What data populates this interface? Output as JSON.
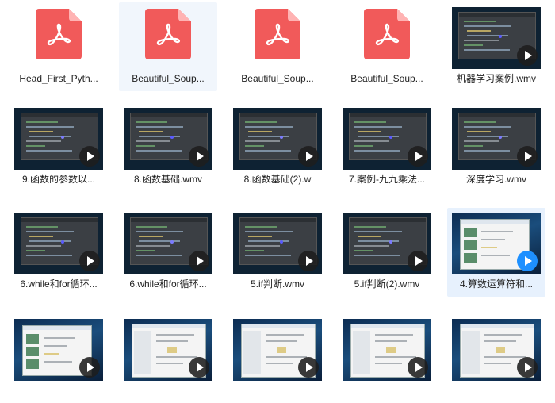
{
  "colors": {
    "pdf_red": "#f15a5a",
    "selection": "#f1f6fc",
    "hover": "#e7f1fd",
    "play_active": "#1e90ff"
  },
  "files": [
    {
      "name": "Head_First_Pyth...",
      "type": "pdf",
      "icon": "pdf-icon"
    },
    {
      "name": "Beautiful_Soup...",
      "type": "pdf",
      "icon": "pdf-icon",
      "state": "selected"
    },
    {
      "name": "Beautiful_Soup...",
      "type": "pdf",
      "icon": "pdf-icon"
    },
    {
      "name": "Beautiful_Soup...",
      "type": "pdf",
      "icon": "pdf-icon"
    },
    {
      "name": "机器学习案例.wmv",
      "type": "video",
      "icon": "play-icon",
      "style": "ide"
    },
    {
      "name": "9.函数的参数以...",
      "type": "video",
      "icon": "play-icon",
      "style": "ide"
    },
    {
      "name": "8.函数基础.wmv",
      "type": "video",
      "icon": "play-icon",
      "style": "ide"
    },
    {
      "name": "8.函数基础(2).w",
      "type": "video",
      "icon": "play-icon",
      "style": "ide"
    },
    {
      "name": "7.案例-九九乘法...",
      "type": "video",
      "icon": "play-icon",
      "style": "ide"
    },
    {
      "name": "深度学习.wmv",
      "type": "video",
      "icon": "play-icon",
      "style": "ide"
    },
    {
      "name": "6.while和for循环...",
      "type": "video",
      "icon": "play-icon",
      "style": "ide"
    },
    {
      "name": "6.while和for循环...",
      "type": "video",
      "icon": "play-icon",
      "style": "ide"
    },
    {
      "name": "5.if判断.wmv",
      "type": "video",
      "icon": "play-icon",
      "style": "ide"
    },
    {
      "name": "5.if判断(2).wmv",
      "type": "video",
      "icon": "play-icon",
      "style": "ide"
    },
    {
      "name": "4.算数运算符和...",
      "type": "video",
      "icon": "play-icon",
      "style": "desktop",
      "state": "hover"
    },
    {
      "name": "",
      "type": "video",
      "icon": "play-icon",
      "style": "desktop"
    },
    {
      "name": "",
      "type": "video",
      "icon": "play-icon",
      "style": "explorer"
    },
    {
      "name": "",
      "type": "video",
      "icon": "play-icon",
      "style": "explorer"
    },
    {
      "name": "",
      "type": "video",
      "icon": "play-icon",
      "style": "explorer"
    },
    {
      "name": "",
      "type": "video",
      "icon": "play-icon",
      "style": "explorer"
    }
  ]
}
